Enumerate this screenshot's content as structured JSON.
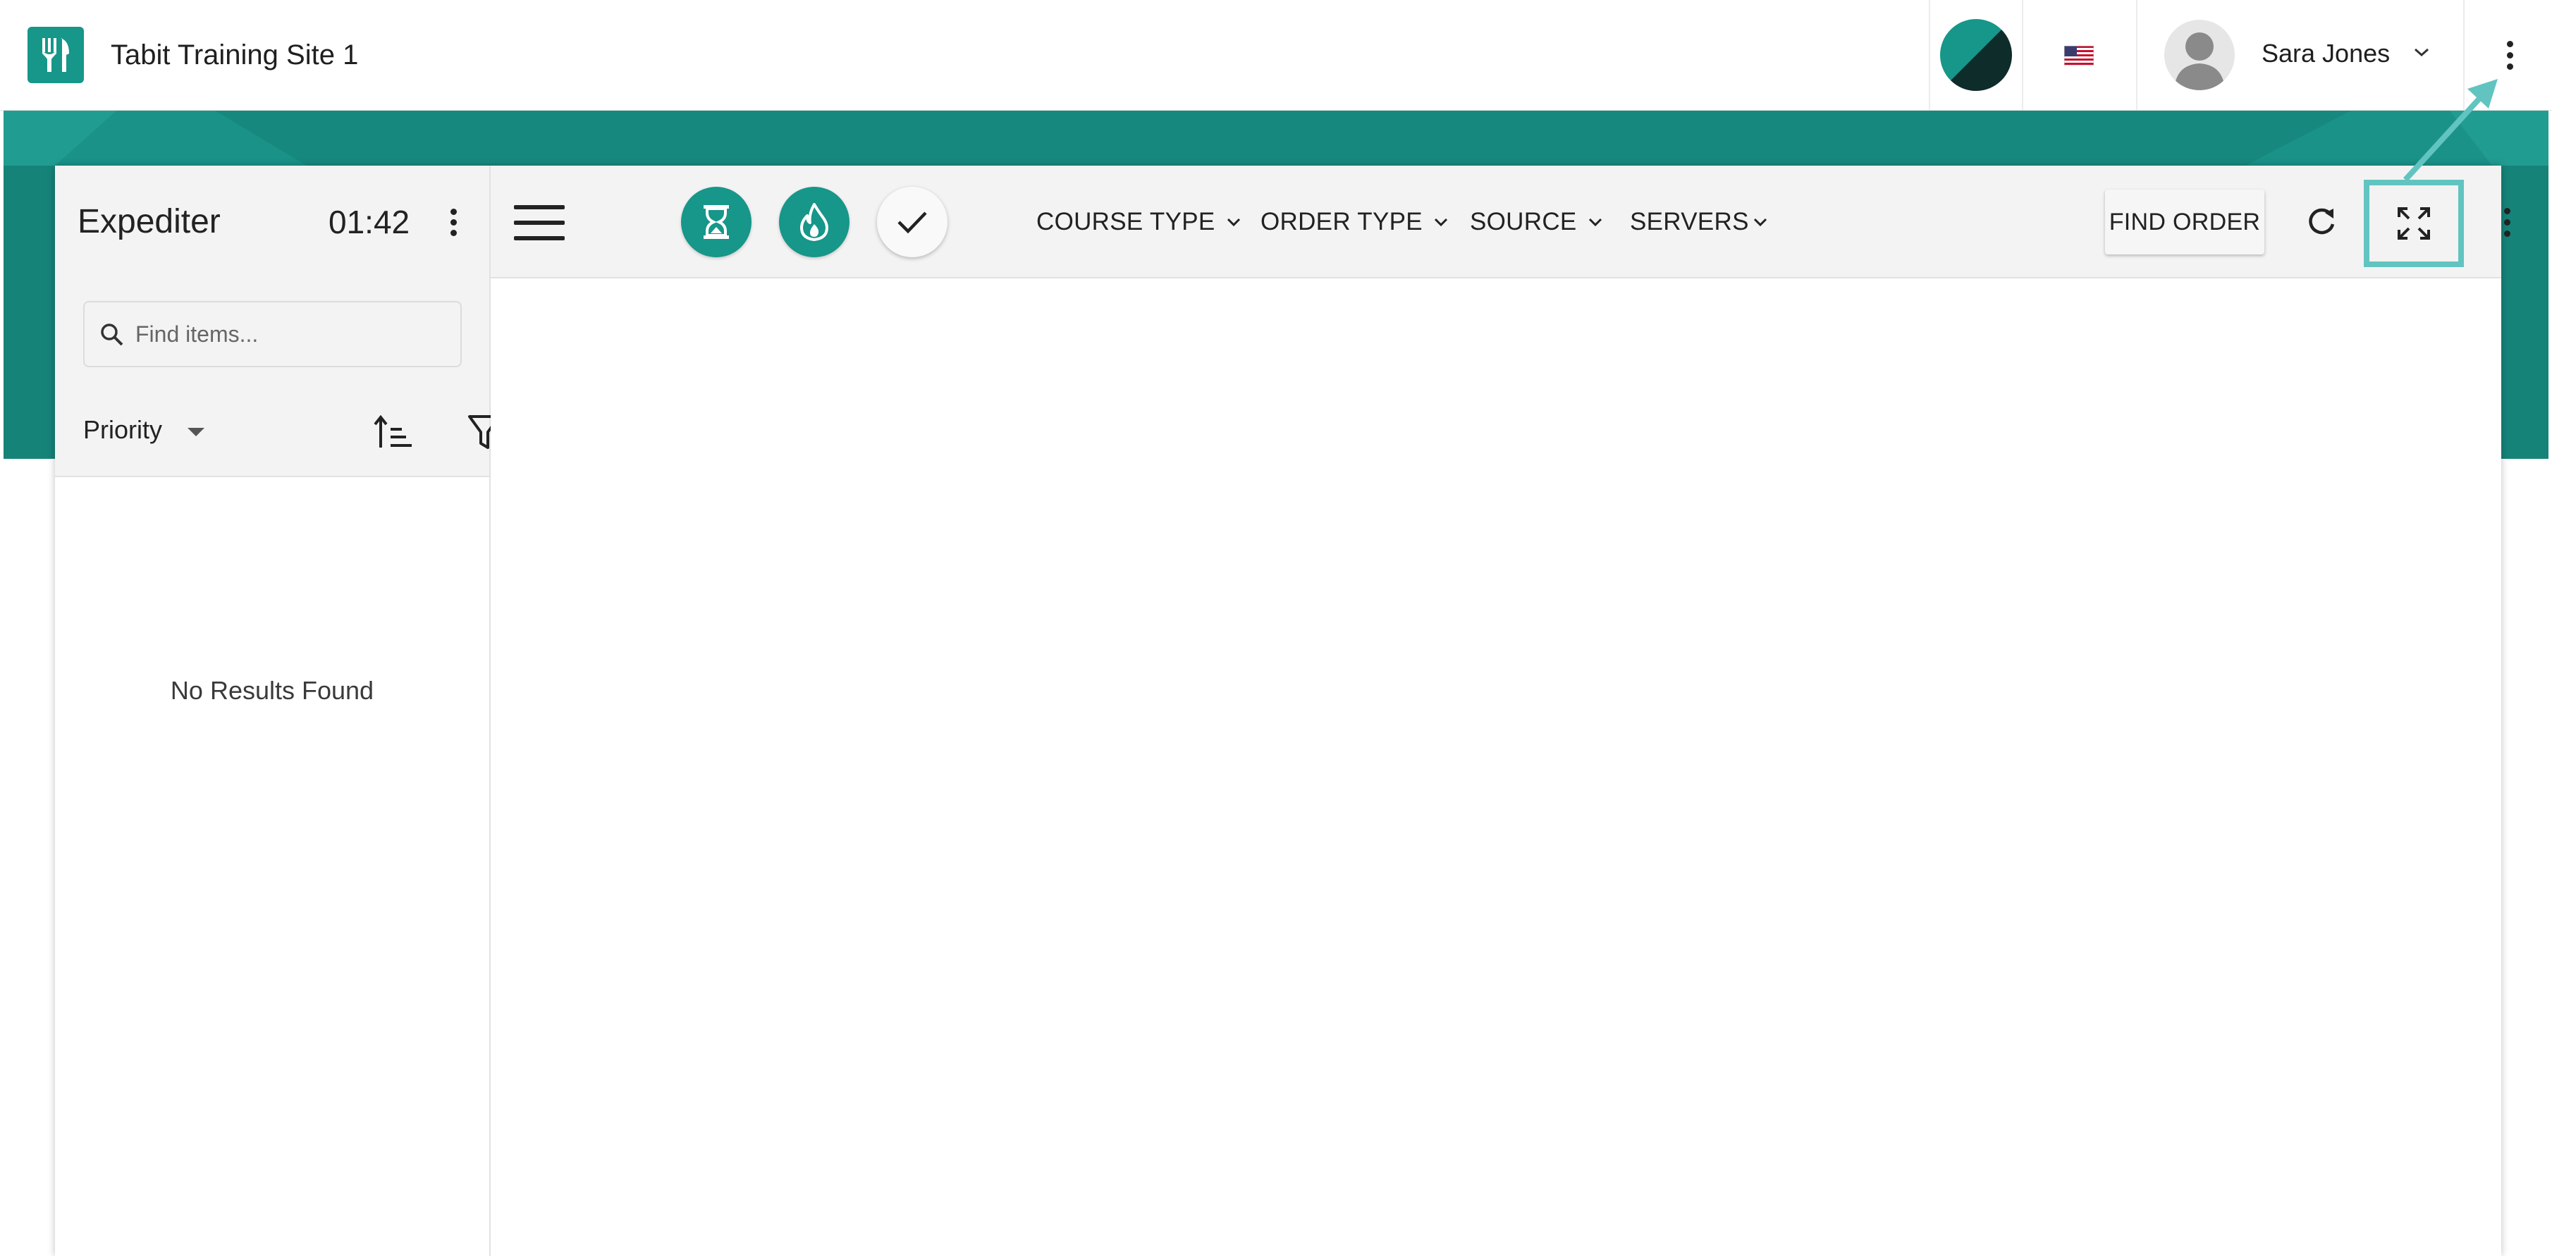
{
  "app": {
    "site_title": "Tabit Training Site 1",
    "user_name": "Sara Jones"
  },
  "left_panel": {
    "title": "Expediter",
    "timer": "01:42",
    "search_placeholder": "Find items...",
    "sort_label": "Priority",
    "empty_message": "No Results Found"
  },
  "toolbar": {
    "filters": [
      {
        "label": "COURSE TYPE"
      },
      {
        "label": "ORDER TYPE"
      },
      {
        "label": "SOURCE"
      },
      {
        "label": "SERVERS"
      }
    ],
    "find_order_label": "FIND ORDER"
  },
  "icons": {
    "logo": "fork-knife-icon",
    "theme": "theme-toggle-icon",
    "flag": "us-flag-icon",
    "pending": "hourglass-icon",
    "fire": "fire-icon",
    "done": "check-icon",
    "refresh": "refresh-icon",
    "fullscreen": "fullscreen-expand-icon"
  },
  "colors": {
    "brand_teal": "#17968a",
    "band_teal": "#17887e",
    "highlight": "#62c4c0"
  }
}
